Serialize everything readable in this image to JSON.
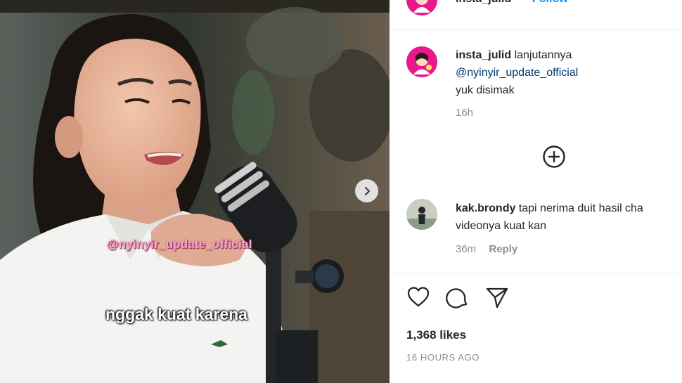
{
  "post": {
    "header": {
      "username": "insta_julid",
      "separator": "•",
      "follow_label": "Follow"
    },
    "media": {
      "watermark": "@nyinyir_update_official",
      "subtitle": "nggak kuat karena",
      "next_icon": "chevron-right-icon"
    },
    "caption": {
      "username": "insta_julid",
      "text_line1": "lanjutannya",
      "mention": "@nyinyir_update_official",
      "text_line3": "yuk disimak",
      "time": "16h"
    },
    "load_more_icon": "plus-circle-icon",
    "comments": [
      {
        "username": "kak.brondy",
        "text_line1": "tapi nerima duit hasil cha",
        "text_line2": "videonya kuat kan",
        "time": "36m",
        "reply_label": "Reply"
      }
    ],
    "actions": {
      "like_icon": "heart-icon",
      "comment_icon": "comment-icon",
      "share_icon": "send-icon"
    },
    "likes": "1,368 likes",
    "timestamp": "16 HOURS AGO"
  },
  "colors": {
    "brand_pink": "#e8198a",
    "link_blue": "#0095f6",
    "mention": "#00376b",
    "muted": "#8e8e8e"
  }
}
